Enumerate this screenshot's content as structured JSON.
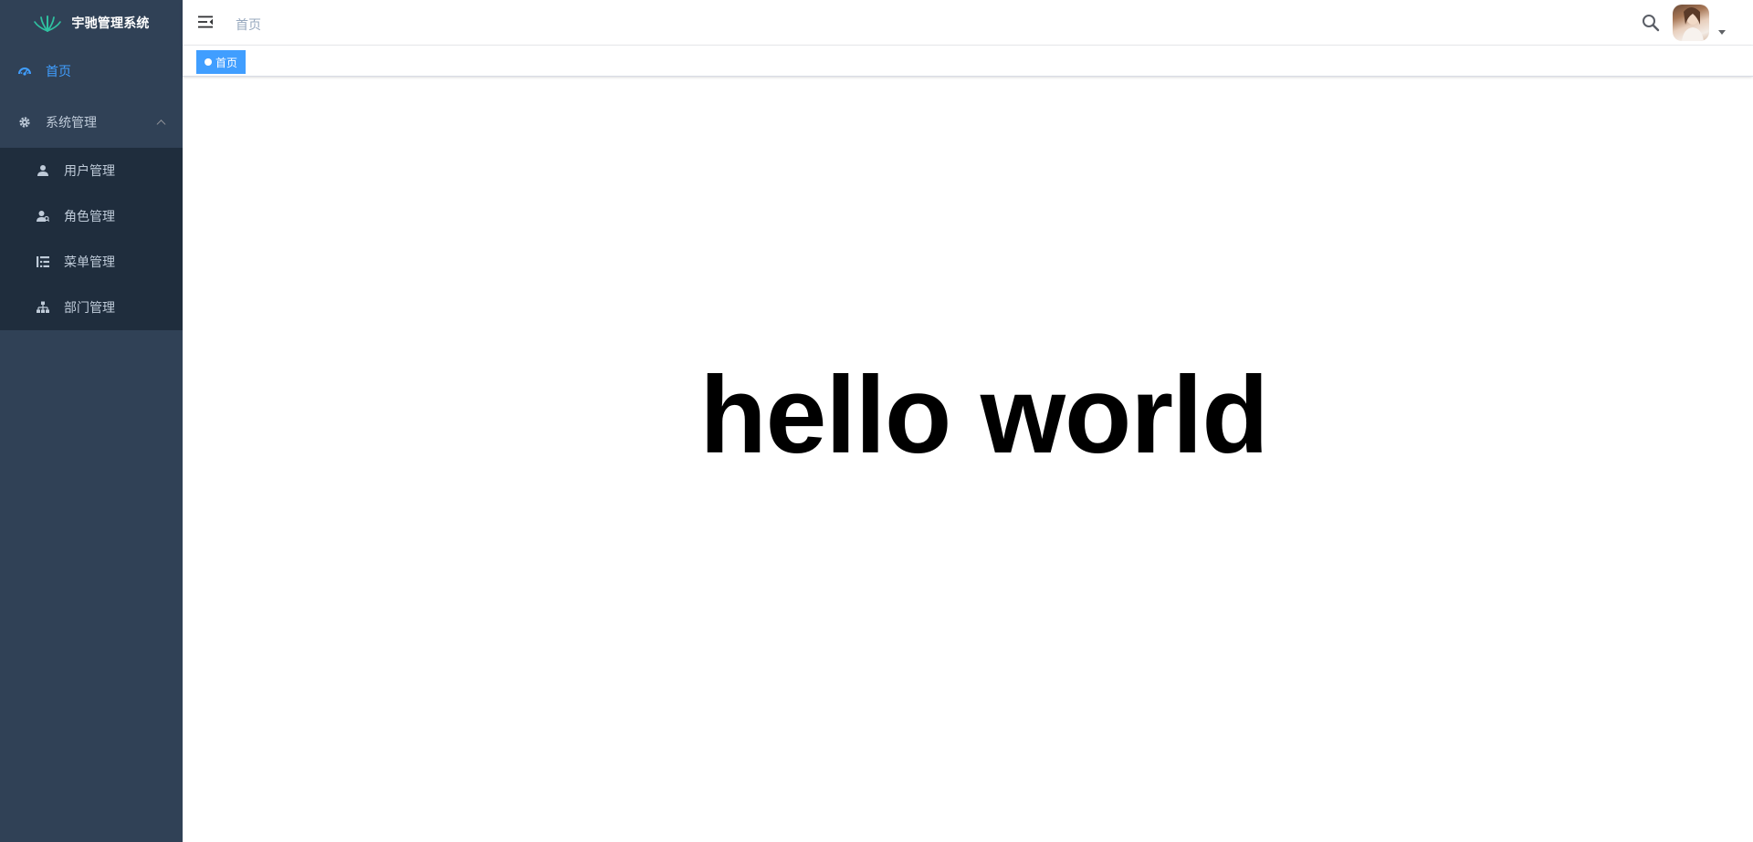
{
  "app": {
    "title": "宇驰管理系统",
    "accent_color": "#409eff",
    "sidebar_bg": "#304156"
  },
  "sidebar": {
    "items": [
      {
        "label": "首页",
        "icon": "dashboard-icon",
        "active": true
      },
      {
        "label": "系统管理",
        "icon": "gear-icon",
        "expanded": true,
        "children": [
          {
            "label": "用户管理",
            "icon": "user-icon"
          },
          {
            "label": "角色管理",
            "icon": "role-icon"
          },
          {
            "label": "菜单管理",
            "icon": "menu-list-icon"
          },
          {
            "label": "部门管理",
            "icon": "org-tree-icon"
          }
        ]
      }
    ]
  },
  "navbar": {
    "breadcrumb": "首页",
    "icons": [
      "hamburger-icon",
      "search-icon",
      "avatar",
      "caret-down-icon"
    ]
  },
  "tags": [
    {
      "label": "首页",
      "active": true
    }
  ],
  "main": {
    "text": "hello world"
  }
}
